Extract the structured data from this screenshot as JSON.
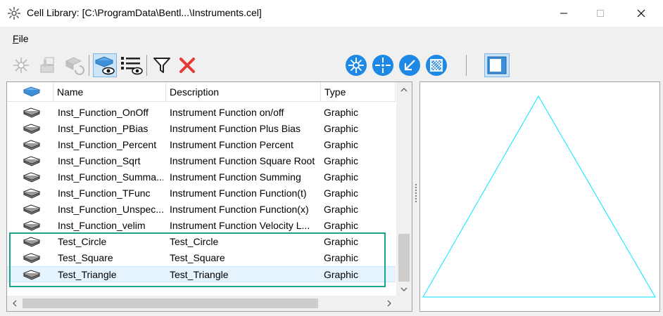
{
  "window": {
    "title": "Cell Library: [C:\\ProgramData\\Bentl...\\Instruments.cel]",
    "icon": "cell-library-icon",
    "minimize_label": "—",
    "maximize_label": "☐",
    "close_label": "✕"
  },
  "menu": {
    "file_prefix": "",
    "file_underline": "F",
    "file_rest": "ile"
  },
  "toolbar": {
    "icons": [
      "create-cell-icon",
      "import-cell-icon",
      "refresh-cell-icon",
      "view-details-icon",
      "view-list-icon",
      "filter-icon",
      "delete-icon",
      "placement-mode-icon",
      "point-mode-icon",
      "terminator-mode-icon",
      "pattern-mode-icon",
      "preview-toggle-icon"
    ],
    "colors": {
      "accent_blue": "#1e88e5",
      "delete_red": "#e53935"
    }
  },
  "table": {
    "columns": [
      {
        "label": ""
      },
      {
        "label": "Name"
      },
      {
        "label": "Description"
      },
      {
        "label": "Type"
      }
    ],
    "rows": [
      {
        "name": "Inst_Function_OnOff",
        "description": "Instrument Function on/off",
        "type": "Graphic",
        "selected": false
      },
      {
        "name": "Inst_Function_PBias",
        "description": "Instrument Function Plus Bias",
        "type": "Graphic",
        "selected": false
      },
      {
        "name": "Inst_Function_Percent",
        "description": "Instrument Function Percent",
        "type": "Graphic",
        "selected": false
      },
      {
        "name": "Inst_Function_Sqrt",
        "description": "Instrument Function Square Root",
        "type": "Graphic",
        "selected": false
      },
      {
        "name": "Inst_Function_Summa...",
        "description": "Instrument Function Summing",
        "type": "Graphic",
        "selected": false
      },
      {
        "name": "Inst_Function_TFunc",
        "description": "Instrument Function Function(t)",
        "type": "Graphic",
        "selected": false
      },
      {
        "name": "Inst_Function_Unspec...",
        "description": "Instrument Function Function(x)",
        "type": "Graphic",
        "selected": false
      },
      {
        "name": "Inst_Function_velim",
        "description": "Instrument Function Velocity L...",
        "type": "Graphic",
        "selected": false
      },
      {
        "name": "Test_Circle",
        "description": "Test_Circle",
        "type": "Graphic",
        "selected": false
      },
      {
        "name": "Test_Square",
        "description": "Test_Square",
        "type": "Graphic",
        "selected": false
      },
      {
        "name": "Test_Triangle",
        "description": "Test_Triangle",
        "type": "Graphic",
        "selected": true
      }
    ]
  },
  "preview": {
    "shape": "triangle",
    "stroke_color": "#00e5ff"
  },
  "highlight": {
    "color": "#1aa58b"
  }
}
